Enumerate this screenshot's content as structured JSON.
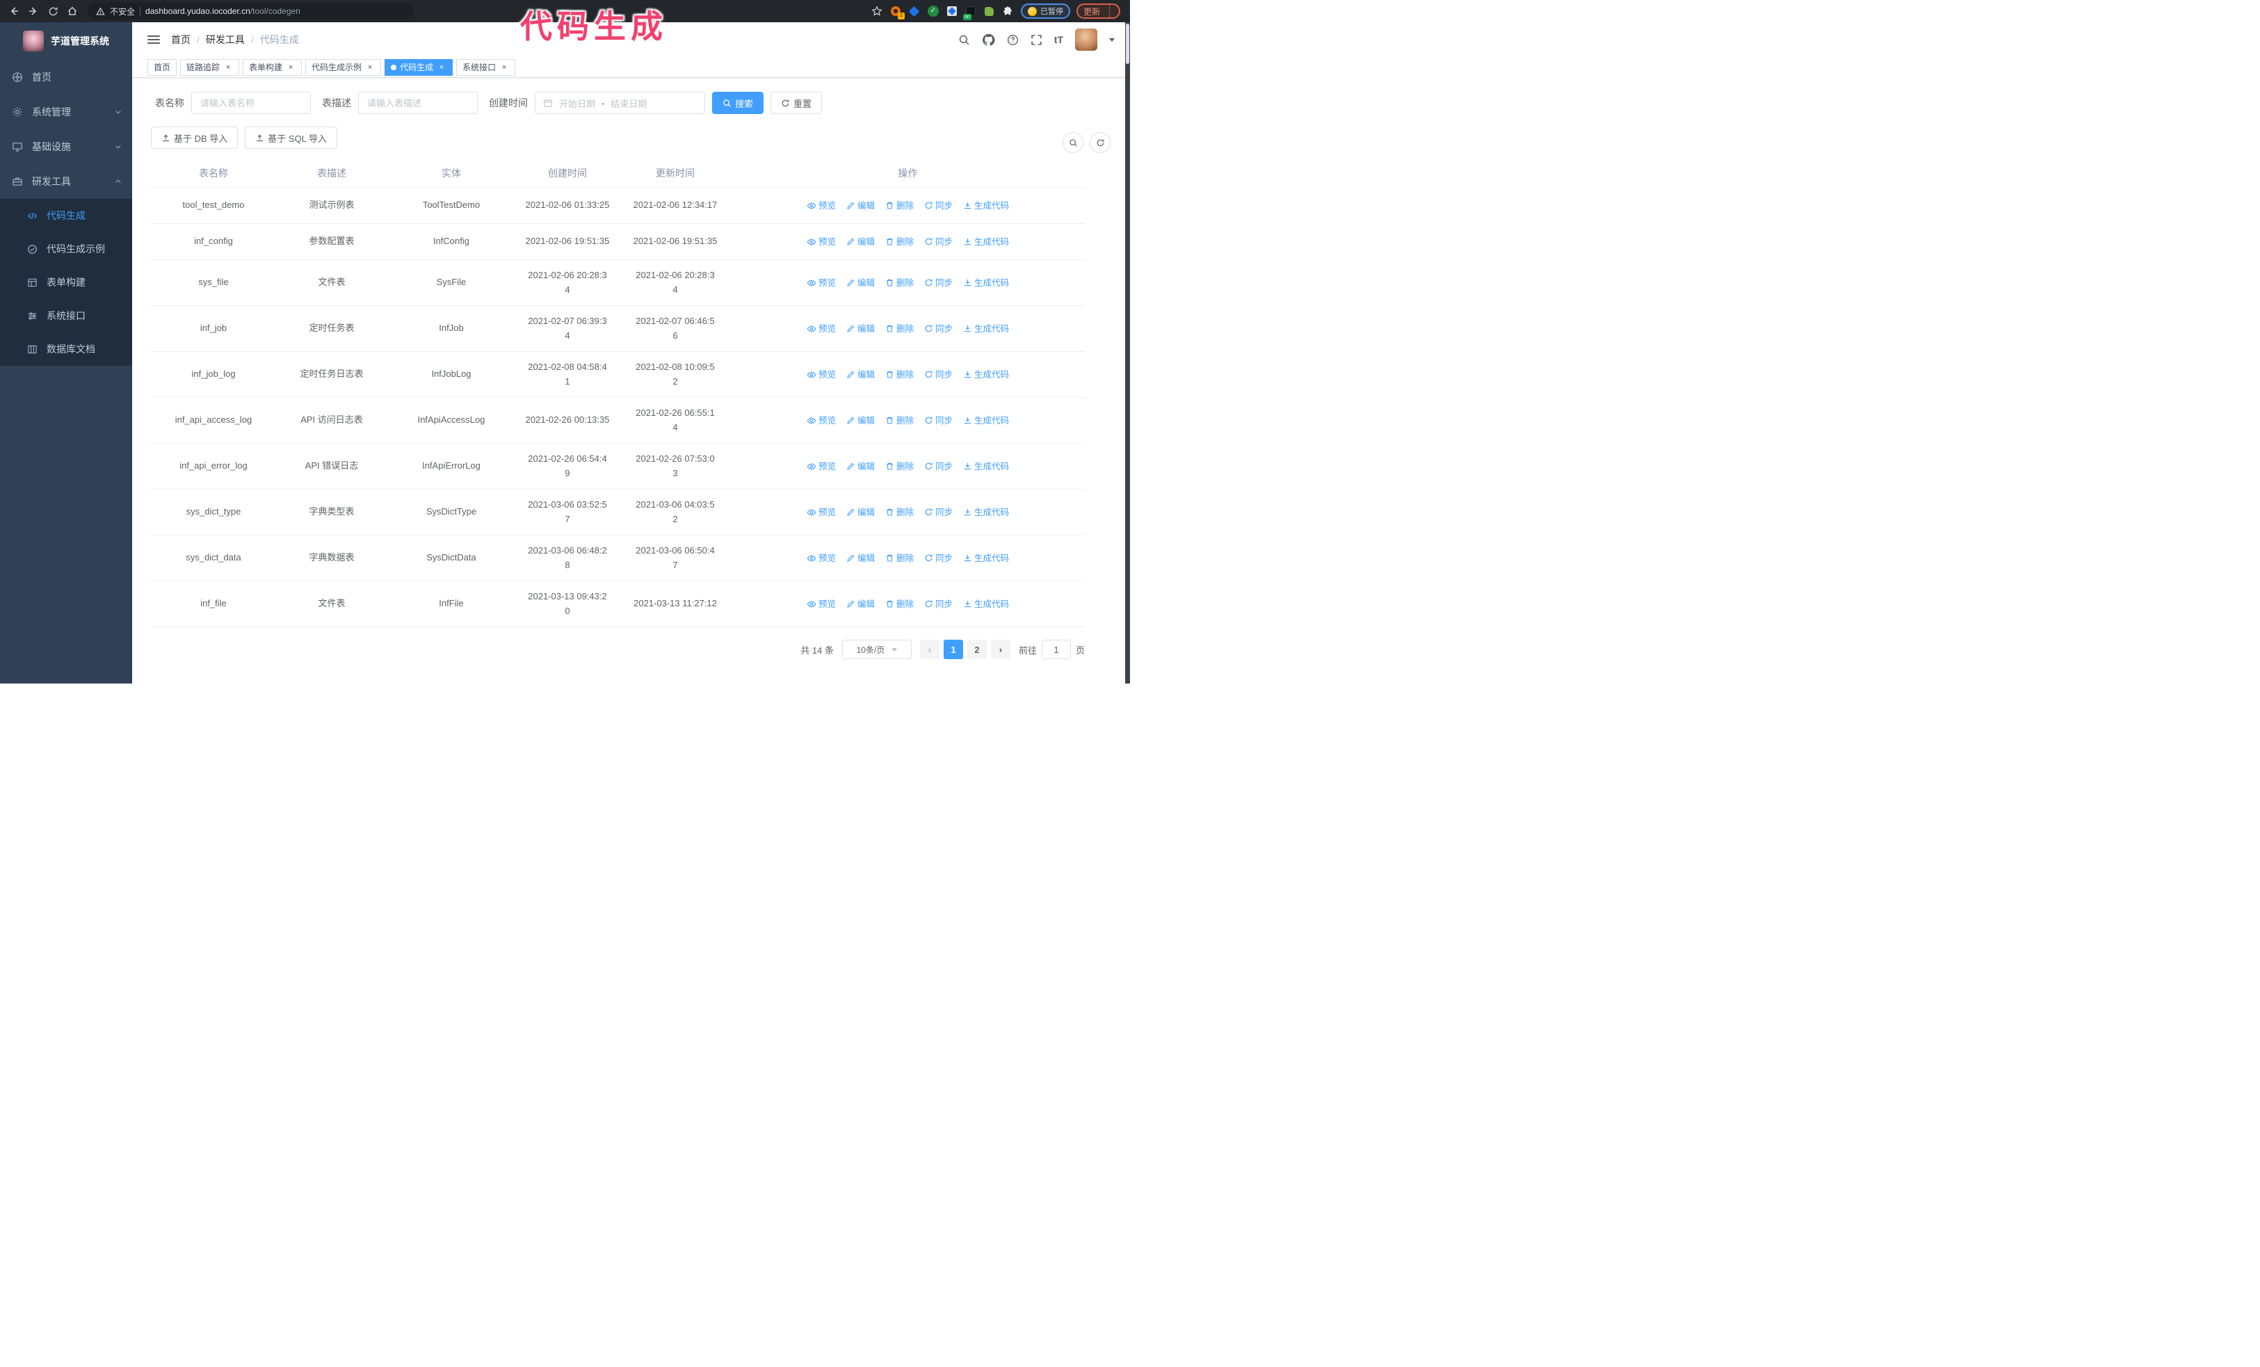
{
  "annotation": {
    "text": "代码生成",
    "color": "#F2406E"
  },
  "browser": {
    "insecure_label": "不安全",
    "url_host": "dashboard.yudao.iocoder.cn",
    "url_path": "/tool/codegen",
    "extension_count_badge": "1",
    "extension_on_badge": "on",
    "paused_badge": "已暂停",
    "update_button": "更新"
  },
  "sidebar": {
    "title": "芋道管理系统",
    "items": [
      {
        "label": "首页",
        "icon": "dashboard",
        "expandable": false,
        "active": false
      },
      {
        "label": "系统管理",
        "icon": "gear",
        "expandable": true,
        "expanded": false,
        "active": false
      },
      {
        "label": "基础设施",
        "icon": "monitor",
        "expandable": true,
        "expanded": false,
        "active": false
      },
      {
        "label": "研发工具",
        "icon": "toolbox",
        "expandable": true,
        "expanded": true,
        "active": false,
        "children": [
          {
            "label": "代码生成",
            "icon": "code",
            "active": true
          },
          {
            "label": "代码生成示例",
            "icon": "check-circle",
            "active": false
          },
          {
            "label": "表单构建",
            "icon": "form",
            "active": false
          },
          {
            "label": "系统接口",
            "icon": "sliders",
            "active": false
          },
          {
            "label": "数据库文档",
            "icon": "columns",
            "active": false
          }
        ]
      }
    ]
  },
  "breadcrumb": {
    "items": [
      "首页",
      "研发工具",
      "代码生成"
    ],
    "separator": "/"
  },
  "tabs": [
    {
      "label": "首页",
      "closable": false,
      "active": false
    },
    {
      "label": "链路追踪",
      "closable": true,
      "active": false
    },
    {
      "label": "表单构建",
      "closable": true,
      "active": false
    },
    {
      "label": "代码生成示例",
      "closable": true,
      "active": false
    },
    {
      "label": "代码生成",
      "closable": true,
      "active": true
    },
    {
      "label": "系统接口",
      "closable": true,
      "active": false
    }
  ],
  "search_form": {
    "table_name_label": "表名称",
    "table_name_placeholder": "请输入表名称",
    "table_desc_label": "表描述",
    "table_desc_placeholder": "请输入表描述",
    "create_time_label": "创建时间",
    "date_start_placeholder": "开始日期",
    "date_separator": "-",
    "date_end_placeholder": "结束日期",
    "search_button": "搜索",
    "reset_button": "重置"
  },
  "toolbar": {
    "import_db_button": "基于 DB 导入",
    "import_sql_button": "基于 SQL 导入"
  },
  "table": {
    "columns": [
      "表名称",
      "表描述",
      "实体",
      "创建时间",
      "更新时间",
      "操作"
    ],
    "actions": [
      "预览",
      "编辑",
      "删除",
      "同步",
      "生成代码"
    ],
    "rows": [
      {
        "name": "tool_test_demo",
        "desc": "测试示例表",
        "entity": "ToolTestDemo",
        "create_time": "2021-02-06 01:33:25",
        "update_time": "2021-02-06 12:34:17",
        "create_wrap": false,
        "update_wrap": false
      },
      {
        "name": "inf_config",
        "desc": "参数配置表",
        "entity": "InfConfig",
        "create_time": "2021-02-06 19:51:35",
        "update_time": "2021-02-06 19:51:35",
        "create_wrap": false,
        "update_wrap": false
      },
      {
        "name": "sys_file",
        "desc": "文件表",
        "entity": "SysFile",
        "create_time": "2021-02-06 20:28:34",
        "update_time": "2021-02-06 20:28:34",
        "create_wrap": true,
        "update_wrap": true
      },
      {
        "name": "inf_job",
        "desc": "定时任务表",
        "entity": "InfJob",
        "create_time": "2021-02-07 06:39:34",
        "update_time": "2021-02-07 06:46:56",
        "create_wrap": true,
        "update_wrap": true
      },
      {
        "name": "inf_job_log",
        "desc": "定时任务日志表",
        "entity": "InfJobLog",
        "create_time": "2021-02-08 04:58:41",
        "update_time": "2021-02-08 10:09:52",
        "create_wrap": true,
        "update_wrap": true
      },
      {
        "name": "inf_api_access_log",
        "desc": "API 访问日志表",
        "entity": "InfApiAccessLog",
        "create_time": "2021-02-26 00:13:35",
        "update_time": "2021-02-26 06:55:14",
        "create_wrap": false,
        "update_wrap": true
      },
      {
        "name": "inf_api_error_log",
        "desc": "API 错误日志",
        "entity": "InfApiErrorLog",
        "create_time": "2021-02-26 06:54:49",
        "update_time": "2021-02-26 07:53:03",
        "create_wrap": true,
        "update_wrap": true
      },
      {
        "name": "sys_dict_type",
        "desc": "字典类型表",
        "entity": "SysDictType",
        "create_time": "2021-03-06 03:52:57",
        "update_time": "2021-03-06 04:03:52",
        "create_wrap": true,
        "update_wrap": true
      },
      {
        "name": "sys_dict_data",
        "desc": "字典数据表",
        "entity": "SysDictData",
        "create_time": "2021-03-06 06:48:28",
        "update_time": "2021-03-06 06:50:47",
        "create_wrap": true,
        "update_wrap": true
      },
      {
        "name": "inf_file",
        "desc": "文件表",
        "entity": "InfFile",
        "create_time": "2021-03-13 09:43:20",
        "update_time": "2021-03-13 11:27:12",
        "create_wrap": true,
        "update_wrap": false
      }
    ]
  },
  "pagination": {
    "total_text": "共 14 条",
    "page_size": "10条/页",
    "pages": [
      "1",
      "2"
    ],
    "active_page": "1",
    "goto_label": "前往",
    "goto_value": "1",
    "goto_suffix": "页"
  },
  "colors": {
    "accent": "#409EFF",
    "sidebar_bg": "#304156",
    "submenu_bg": "#1f2d3d",
    "annotation": "#F2406E",
    "table_border": "#ebeef5"
  }
}
